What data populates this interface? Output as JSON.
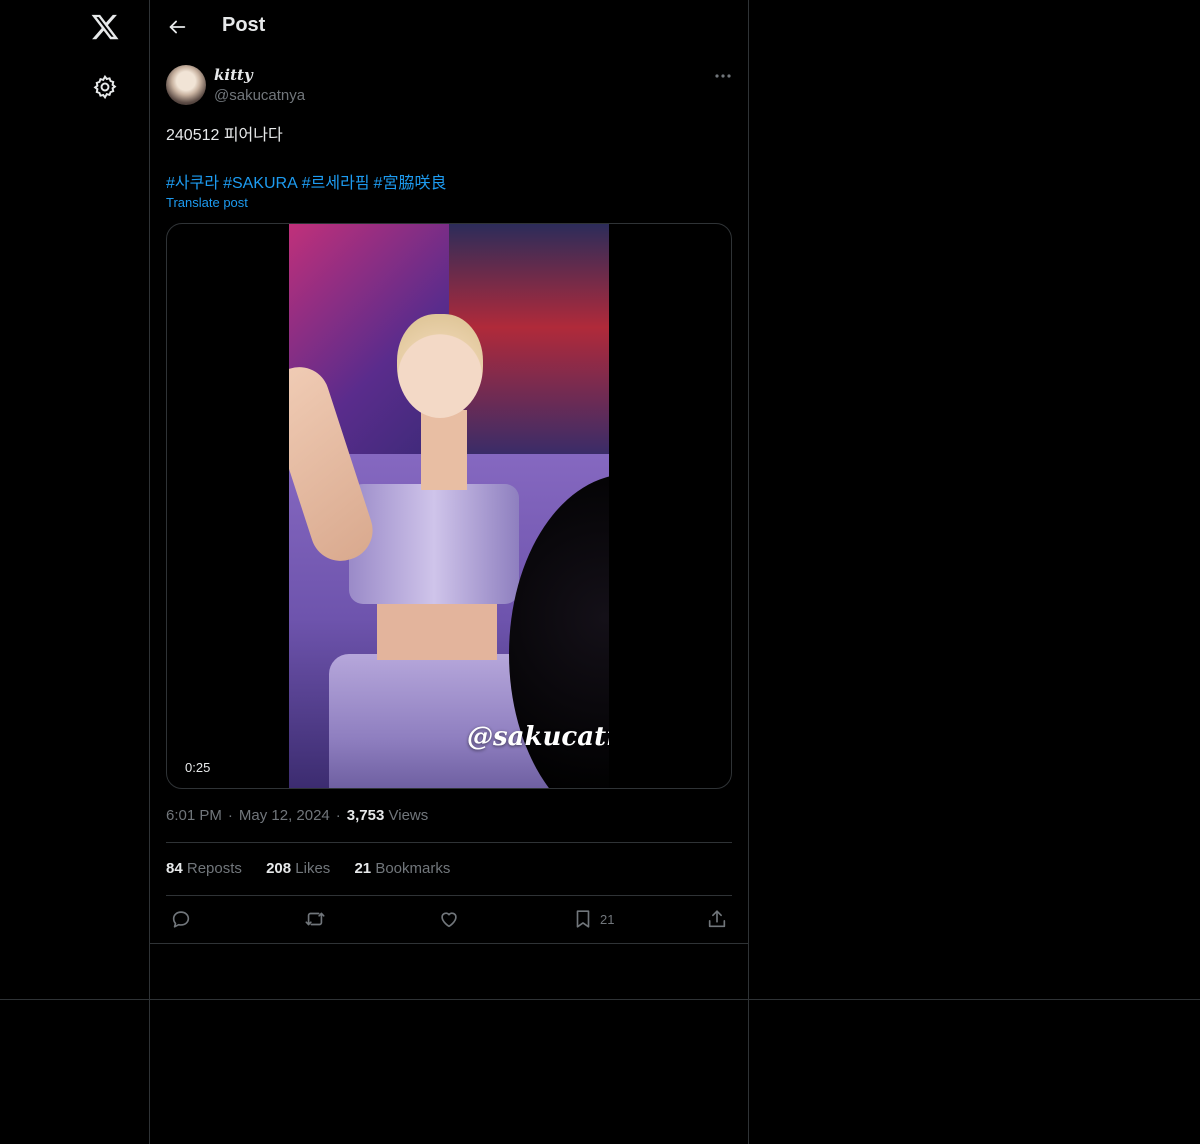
{
  "nav": {
    "logo_icon": "x-logo-icon",
    "settings_icon": "gear-icon"
  },
  "header": {
    "title": "Post"
  },
  "post": {
    "display_name": "kitty",
    "handle": "@sakucatnya",
    "text": "240512 피어나다",
    "hashtags": [
      "#사쿠라",
      "#SAKURA",
      "#르세라핌",
      "#宮脇咲良"
    ],
    "translate_label": "Translate post",
    "media": {
      "watermark": "@sakucatnya",
      "duration": "0:25"
    },
    "time": "6:01 PM",
    "date": "May 12, 2024",
    "views_count": "3,753",
    "views_label": "Views",
    "stats": {
      "reposts_count": "84",
      "reposts_label": "Reposts",
      "likes_count": "208",
      "likes_label": "Likes",
      "bookmarks_count": "21",
      "bookmarks_label": "Bookmarks"
    },
    "actions": {
      "bookmark_count": "21"
    }
  },
  "colors": {
    "background": "#000000",
    "text": "#e7e9ea",
    "muted": "#71767b",
    "accent": "#1d9bf0",
    "border": "#2f3336"
  }
}
